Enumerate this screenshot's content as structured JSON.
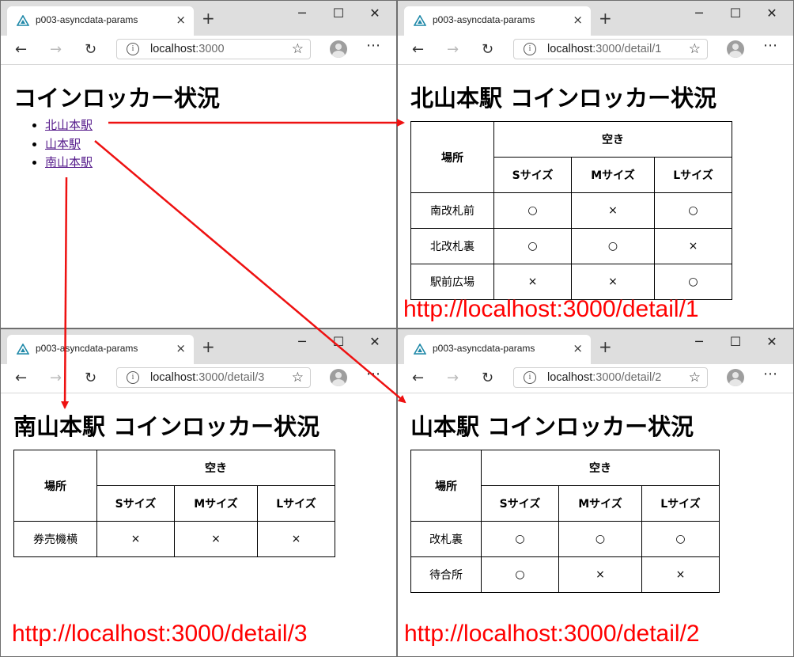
{
  "browser": {
    "tab_title": "p003-asyncdata-params",
    "tab_close_icon": "×",
    "new_tab_icon": "+",
    "min_icon": "─",
    "max_icon": "☐",
    "close_icon": "✕",
    "back_icon": "←",
    "forward_icon": "→",
    "reload_icon": "↻",
    "info_icon": "i",
    "star_icon": "☆",
    "more_icon": "⋯",
    "host": "localhost",
    "accent": "#1e88a8"
  },
  "index": {
    "url_port": ":3000",
    "url_path": "",
    "heading": "コインロッカー状況",
    "stations": [
      "北山本駅",
      "山本駅",
      "南山本駅"
    ]
  },
  "table_header": {
    "place": "場所",
    "vacancy": "空き",
    "s": "Sサイズ",
    "m": "Mサイズ",
    "l": "Lサイズ"
  },
  "detail1": {
    "url_port": ":3000",
    "url_path": "/detail/1",
    "heading": "北山本駅 コインロッカー状況",
    "rows": [
      {
        "place": "南改札前",
        "s": "○",
        "m": "×",
        "l": "○"
      },
      {
        "place": "北改札裏",
        "s": "○",
        "m": "○",
        "l": "×"
      },
      {
        "place": "駅前広場",
        "s": "×",
        "m": "×",
        "l": "○"
      }
    ]
  },
  "detail2": {
    "url_port": ":3000",
    "url_path": "/detail/2",
    "heading": "山本駅 コインロッカー状況",
    "rows": [
      {
        "place": "改札裏",
        "s": "○",
        "m": "○",
        "l": "○"
      },
      {
        "place": "待合所",
        "s": "○",
        "m": "×",
        "l": "×"
      }
    ]
  },
  "detail3": {
    "url_port": ":3000",
    "url_path": "/detail/3",
    "heading": "南山本駅 コインロッカー状況",
    "rows": [
      {
        "place": "券売機横",
        "s": "×",
        "m": "×",
        "l": "×"
      }
    ]
  },
  "captions": {
    "detail1": "http://localhost:3000/detail/1",
    "detail2": "http://localhost:3000/detail/2",
    "detail3": "http://localhost:3000/detail/3"
  },
  "annotation_color": "#ee1111"
}
